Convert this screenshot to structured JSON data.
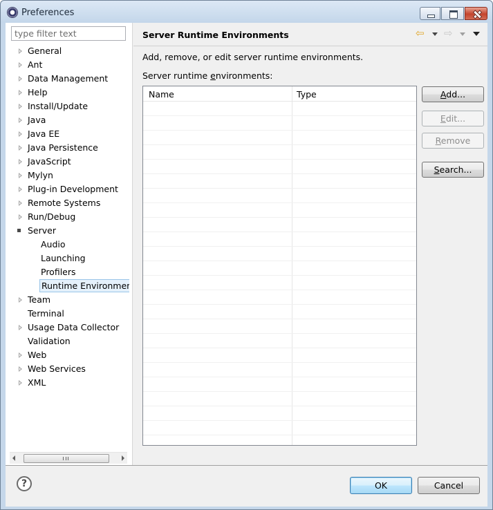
{
  "window": {
    "title": "Preferences"
  },
  "filter": {
    "placeholder": "type filter text"
  },
  "tree": {
    "items": [
      {
        "label": "General",
        "expandable": true
      },
      {
        "label": "Ant",
        "expandable": true
      },
      {
        "label": "Data Management",
        "expandable": true
      },
      {
        "label": "Help",
        "expandable": true
      },
      {
        "label": "Install/Update",
        "expandable": true
      },
      {
        "label": "Java",
        "expandable": true
      },
      {
        "label": "Java EE",
        "expandable": true
      },
      {
        "label": "Java Persistence",
        "expandable": true
      },
      {
        "label": "JavaScript",
        "expandable": true
      },
      {
        "label": "Mylyn",
        "expandable": true
      },
      {
        "label": "Plug-in Development",
        "expandable": true
      },
      {
        "label": "Remote Systems",
        "expandable": true
      },
      {
        "label": "Run/Debug",
        "expandable": true
      },
      {
        "label": "Server",
        "expandable": true,
        "expanded": true
      },
      {
        "label": "Audio",
        "child": true
      },
      {
        "label": "Launching",
        "child": true
      },
      {
        "label": "Profilers",
        "child": true
      },
      {
        "label": "Runtime Environment",
        "child": true,
        "selected": true
      },
      {
        "label": "Team",
        "expandable": true
      },
      {
        "label": "Terminal",
        "expandable": false
      },
      {
        "label": "Usage Data Collector",
        "expandable": true
      },
      {
        "label": "Validation",
        "expandable": false
      },
      {
        "label": "Web",
        "expandable": true
      },
      {
        "label": "Web Services",
        "expandable": true
      },
      {
        "label": "XML",
        "expandable": true
      }
    ]
  },
  "page": {
    "title": "Server Runtime Environments",
    "description": "Add, remove, or edit server runtime environments.",
    "table_label": "Server runtime environments:",
    "table": {
      "columns": [
        "Name",
        "Type"
      ],
      "rows": []
    },
    "buttons": {
      "add": "Add...",
      "edit": "Edit...",
      "remove": "Remove",
      "search": "Search..."
    }
  },
  "dialog": {
    "ok": "OK",
    "cancel": "Cancel",
    "help": "?"
  },
  "colors": {
    "selection_bg": "#e5f1fb",
    "selection_border": "#99c5e8",
    "ok_accent": "#3c7fb1",
    "back_arrow": "#e1a72c"
  },
  "icons": [
    "app-icon",
    "minimize-icon",
    "maximize-icon",
    "close-icon",
    "back-arrow-icon",
    "forward-arrow-icon",
    "view-menu-icon",
    "help-icon"
  ]
}
